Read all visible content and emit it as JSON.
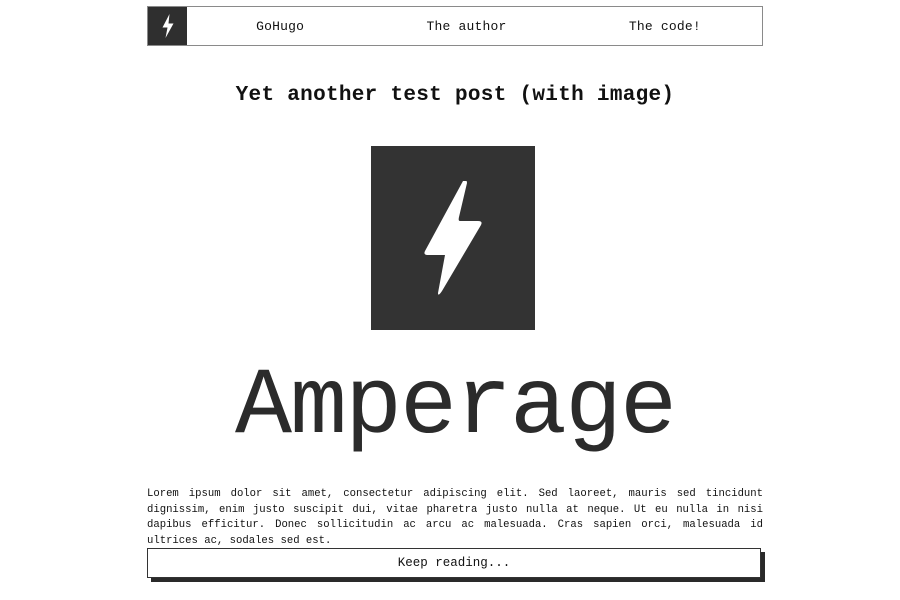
{
  "nav": {
    "logo_icon": "lightning-bolt-icon",
    "links": [
      {
        "label": "GoHugo"
      },
      {
        "label": "The author"
      },
      {
        "label": "The code!"
      }
    ]
  },
  "post": {
    "title": "Yet another test post (with image)",
    "image_icon": "lightning-bolt-icon",
    "wordmark": "Amperage",
    "excerpt": "Lorem ipsum dolor sit amet, consectetur adipiscing elit. Sed laoreet, mauris sed tincidunt dignissim, enim justo suscipit dui, vitae pharetra justo nulla at neque. Ut eu nulla in nisi dapibus efficitur. Donec sollicitudin ac arcu ac malesuada. Cras sapien orci, malesuada id ultrices ac, sodales sed est.",
    "read_more_label": "Keep reading..."
  },
  "colors": {
    "logo_bg": "#2f2f2f",
    "image_bg": "#333333",
    "text": "#111111",
    "background": "#ffffff"
  }
}
